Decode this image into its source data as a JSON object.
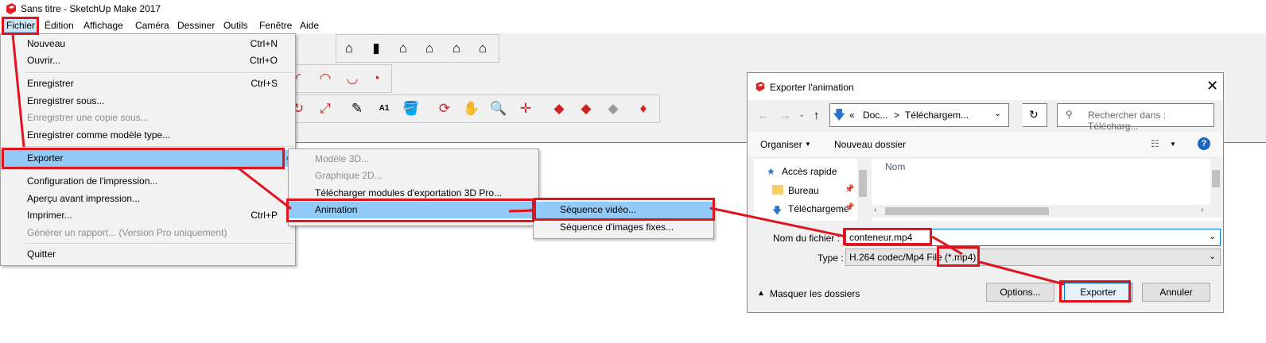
{
  "window": {
    "title": "Sans titre - SketchUp Make 2017",
    "accent": "#e0141e"
  },
  "menubar": [
    "Fichier",
    "Édition",
    "Affichage",
    "Caméra",
    "Dessiner",
    "Outils",
    "Fenêtre",
    "Aide"
  ],
  "file_menu": {
    "items": [
      {
        "label": "Nouveau",
        "shortcut": "Ctrl+N"
      },
      {
        "label": "Ouvrir...",
        "shortcut": "Ctrl+O"
      },
      {
        "label": "Enregistrer",
        "shortcut": "Ctrl+S"
      },
      {
        "label": "Enregistrer sous...",
        "shortcut": ""
      },
      {
        "label": "Enregistrer une copie sous...",
        "shortcut": "",
        "disabled": true
      },
      {
        "label": "Enregistrer comme modèle type...",
        "shortcut": ""
      },
      {
        "label": "Exporter",
        "shortcut": "",
        "selected": true
      },
      {
        "label": "Configuration de l'impression...",
        "shortcut": ""
      },
      {
        "label": "Aperçu avant impression...",
        "shortcut": ""
      },
      {
        "label": "Imprimer...",
        "shortcut": "Ctrl+P"
      },
      {
        "label": "Générer un rapport... (Version Pro uniquement)",
        "shortcut": "",
        "disabled": true
      },
      {
        "label": "Quitter",
        "shortcut": ""
      }
    ]
  },
  "export_menu": {
    "items": [
      {
        "label": "Modèle 3D...",
        "disabled": true
      },
      {
        "label": "Graphique 2D...",
        "disabled": true
      },
      {
        "label": "Télécharger modules d'exportation 3D Pro..."
      },
      {
        "label": "Animation",
        "selected": true
      }
    ]
  },
  "animation_menu": {
    "items": [
      {
        "label": "Séquence vidéo...",
        "selected": true
      },
      {
        "label": "Séquence d'images fixes..."
      }
    ]
  },
  "text_tool_label": "A1",
  "dialog": {
    "title": "Exporter l'animation",
    "breadcrumb": {
      "prefix": "«",
      "folder1": "Doc...",
      "sep": ">",
      "folder2": "Téléchargem..."
    },
    "search_placeholder": "Rechercher dans : Télécharg...",
    "organize": "Organiser",
    "new_folder": "Nouveau dossier",
    "nav": {
      "quick_access": "Accès rapide",
      "desktop": "Bureau",
      "downloads": "Téléchargeme"
    },
    "column_name": "Nom",
    "filename_label": "Nom du fichier :",
    "filename_value": "conteneur.mp4",
    "type_label": "Type :",
    "type_value": "H.264 codec/Mp4 File (*.mp4)",
    "hide_folders": "Masquer les dossiers",
    "options_button": "Options...",
    "export_button": "Exporter",
    "cancel_button": "Annuler"
  }
}
